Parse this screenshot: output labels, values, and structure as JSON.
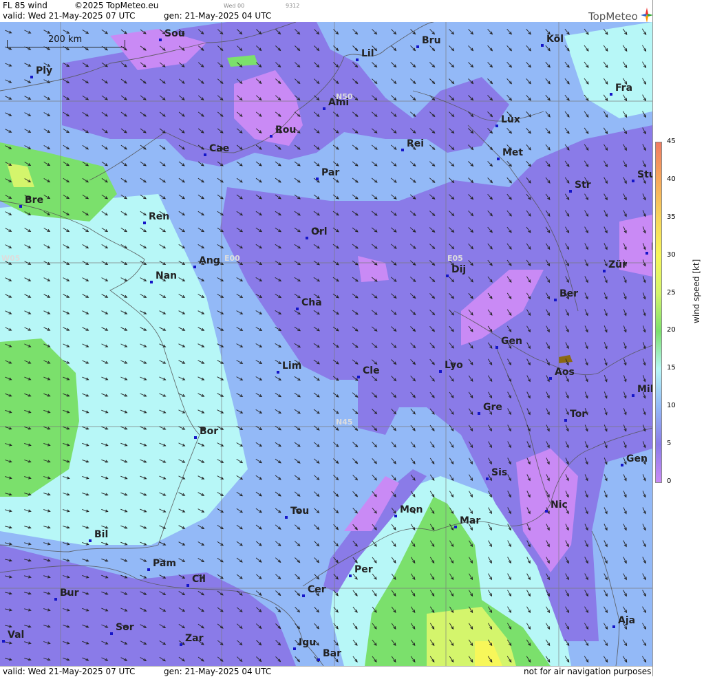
{
  "header": {
    "title": "FL 85 wind",
    "copyright": "©2025 TopMeteo.eu",
    "valid": "valid:  Wed  21-May-2025  07 UTC",
    "generated": "gen: 21-May-2025 04 UTC",
    "small_label_1": "Wed 00",
    "small_label_2": "9312",
    "logo": "TopMeteo"
  },
  "footer": {
    "valid": "valid:  Wed  21-May-2025  07 UTC",
    "generated": "gen: 21-May-2025 04 UTC",
    "disclaimer": "not for air navigation purposes"
  },
  "scale_bar": {
    "label": "200 km"
  },
  "grid_labels": {
    "n50": "N50",
    "n45": "N45",
    "w05": "W05",
    "e00": "E00",
    "e05": "E05"
  },
  "cities": [
    {
      "name": "Sou"
    },
    {
      "name": "Ply"
    },
    {
      "name": "Lil"
    },
    {
      "name": "Bru"
    },
    {
      "name": "Köl"
    },
    {
      "name": "Ami"
    },
    {
      "name": "Fra"
    },
    {
      "name": "Rou"
    },
    {
      "name": "Lux"
    },
    {
      "name": "Cae"
    },
    {
      "name": "Rei"
    },
    {
      "name": "Met"
    },
    {
      "name": "Par"
    },
    {
      "name": "Str"
    },
    {
      "name": "Stu"
    },
    {
      "name": "Bre"
    },
    {
      "name": "Ren"
    },
    {
      "name": "Orl"
    },
    {
      "name": "Ang"
    },
    {
      "name": "Dij"
    },
    {
      "name": "Zür"
    },
    {
      "name": "Nan"
    },
    {
      "name": "Cha"
    },
    {
      "name": "Ber"
    },
    {
      "name": "Gen"
    },
    {
      "name": "Lim"
    },
    {
      "name": "Cle"
    },
    {
      "name": "Lyo"
    },
    {
      "name": "Aos"
    },
    {
      "name": "Mil"
    },
    {
      "name": "Gre"
    },
    {
      "name": "Tor"
    },
    {
      "name": "Bor"
    },
    {
      "name": "Gen"
    },
    {
      "name": "Sis"
    },
    {
      "name": "Nic"
    },
    {
      "name": "Tou"
    },
    {
      "name": "Mon"
    },
    {
      "name": "Mar"
    },
    {
      "name": "Bil"
    },
    {
      "name": "Pam"
    },
    {
      "name": "Per"
    },
    {
      "name": "Cil"
    },
    {
      "name": "Bur"
    },
    {
      "name": "Cer"
    },
    {
      "name": "Aja"
    },
    {
      "name": "Sor"
    },
    {
      "name": "Val"
    },
    {
      "name": "Zar"
    },
    {
      "name": "Igu"
    },
    {
      "name": "Bar"
    },
    {
      "name": "F"
    }
  ],
  "legend": {
    "title": "wind  speed  [kt]",
    "ticks": [
      "45",
      "40",
      "35",
      "30",
      "25",
      "20",
      "15",
      "10",
      "5",
      "0"
    ],
    "colors": [
      "#ef7b62",
      "#f7a85a",
      "#f7d55a",
      "#f7f75a",
      "#d4f56c",
      "#7be06c",
      "#b7f7f7",
      "#93b9f7",
      "#8a7be8",
      "#c98af5"
    ]
  },
  "colors": {
    "band_0_5": "#c98af5",
    "band_5_10": "#8a7be8",
    "band_10_15": "#93b9f7",
    "band_15_20": "#b7f7f7",
    "band_20_25": "#7be06c",
    "band_25_30": "#d4f56c",
    "band_30_35": "#f7f75a",
    "terrain_blocked": "#8b6914",
    "city_dot": "#1515c8"
  }
}
